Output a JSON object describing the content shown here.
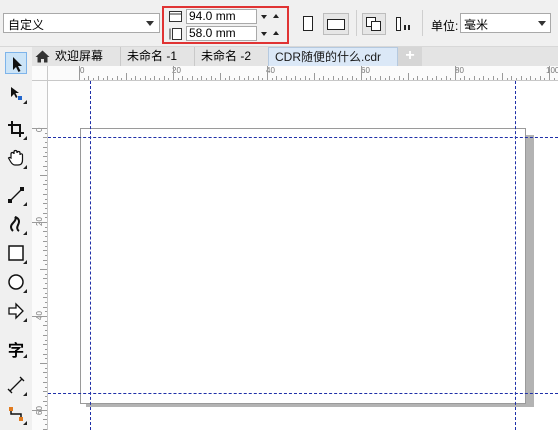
{
  "property_bar": {
    "preset": "自定义",
    "width_value": "94.0 mm",
    "height_value": "58.0 mm",
    "units_label": "单位:",
    "units_value": "毫米"
  },
  "tabs": [
    {
      "label": "欢迎屏幕"
    },
    {
      "label": "未命名 -1"
    },
    {
      "label": "未命名 -2"
    },
    {
      "label": "CDR随便的什么.cdr"
    }
  ],
  "rulers": {
    "horizontal": [
      "0",
      "20",
      "40",
      "60",
      "80",
      "100"
    ],
    "vertical": [
      "0",
      "20",
      "40",
      "60"
    ]
  },
  "toolbox": [
    "pick-tool-icon",
    "shape-tool-icon",
    "crop-tool-icon",
    "pan-tool-icon",
    "freehand-tool-icon",
    "artistic-media-icon",
    "rectangle-tool-icon",
    "ellipse-tool-icon",
    "basic-shapes-icon",
    "text-tool-icon",
    "dimension-tool-icon",
    "connector-tool-icon"
  ],
  "text_tool_glyph": "字",
  "colors": {
    "highlight": "#e03333",
    "guide": "#1e2fa8",
    "active_tab": "#dbe8f7"
  }
}
